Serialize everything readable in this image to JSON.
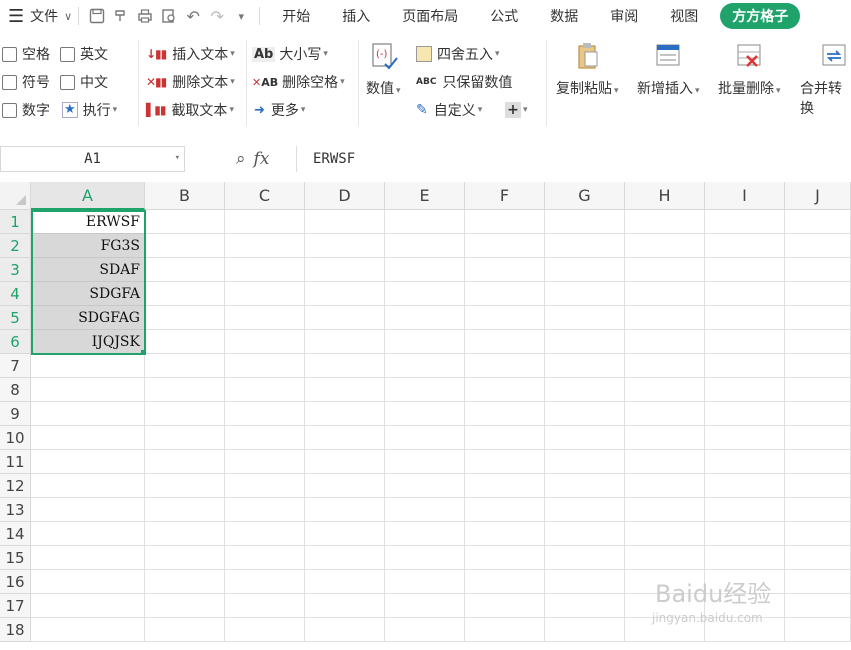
{
  "menubar": {
    "file_label": "文件",
    "tabs": [
      "开始",
      "插入",
      "页面布局",
      "公式",
      "数据",
      "审阅",
      "视图"
    ],
    "active_tab": "方方格子"
  },
  "ribbon": {
    "checkboxes": [
      "空格",
      "英文",
      "符号",
      "中文",
      "数字"
    ],
    "execute": "执行",
    "text_tools": [
      "插入文本",
      "删除文本",
      "截取文本"
    ],
    "case_tools": [
      "大小写",
      "删除空格",
      "更多"
    ],
    "numeric": "数值",
    "rounding": "四舍五入",
    "keep_numeric": "只保留数值",
    "custom": "自定义",
    "big_buttons": [
      "复制粘贴",
      "新增插入",
      "批量删除",
      "合并转换"
    ]
  },
  "formula_bar": {
    "name_box": "A1",
    "fx": "fx",
    "content": "ERWSF"
  },
  "sheet": {
    "columns": [
      "A",
      "B",
      "C",
      "D",
      "E",
      "F",
      "G",
      "H",
      "I",
      "J"
    ],
    "rows": [
      "1",
      "2",
      "3",
      "4",
      "5",
      "6",
      "7",
      "8",
      "9",
      "10",
      "11",
      "12",
      "13",
      "14",
      "15",
      "16",
      "17",
      "18"
    ],
    "column_a_values": [
      "ERWSF",
      "FG3S",
      "SDAF",
      "SDGFA",
      "SDGFAG",
      "IJQJSK"
    ]
  },
  "watermark": {
    "brand": "Baidu经验",
    "url": "jingyan.baidu.com"
  },
  "colors": {
    "accent": "#1fa36b"
  }
}
